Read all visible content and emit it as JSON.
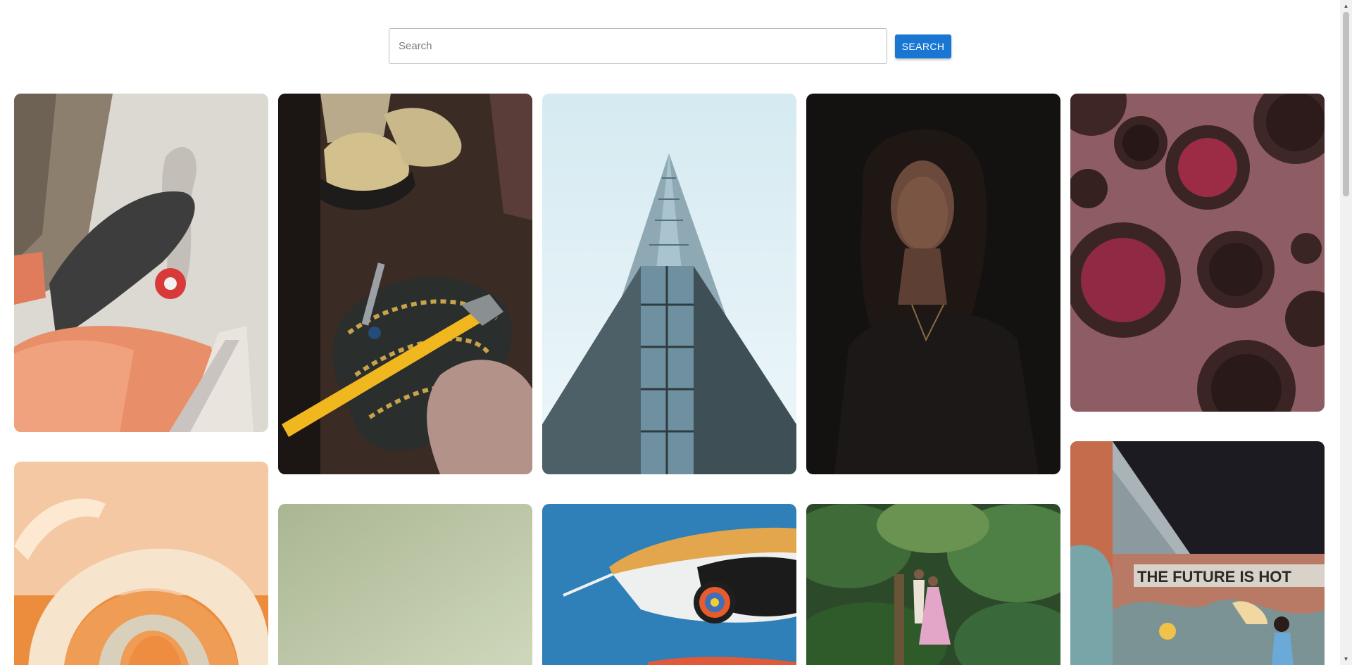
{
  "search": {
    "placeholder": "Search",
    "value": "",
    "button_label": "SEARCH",
    "button_color": "#1976d2"
  },
  "gallery": {
    "columns": [
      {
        "photos": [
          {
            "subject": "skateboard-photo",
            "palette": [
              "#d9d5cf",
              "#e8956f",
              "#3b3b3b"
            ]
          },
          {
            "subject": "arches-render-photo",
            "palette": [
              "#f2c49a",
              "#e88a3e",
              "#c9c0a8"
            ]
          }
        ]
      },
      {
        "photos": [
          {
            "subject": "climbing-gear-photo",
            "palette": [
              "#3a2a24",
              "#e8b72c",
              "#b19088"
            ]
          },
          {
            "subject": "green-gradient-photo",
            "palette": [
              "#b8c2a3",
              "#c8d1b4"
            ]
          }
        ]
      },
      {
        "photos": [
          {
            "subject": "skyscraper-photo",
            "palette": [
              "#dfeef3",
              "#6b8590",
              "#2f4047"
            ]
          },
          {
            "subject": "koi-kite-photo",
            "palette": [
              "#2d7ab5",
              "#e2a24a",
              "#1e1e1e"
            ]
          }
        ]
      },
      {
        "photos": [
          {
            "subject": "portrait-woman-photo",
            "palette": [
              "#141111",
              "#2a1f1c",
              "#6a4a3c"
            ]
          },
          {
            "subject": "garden-couple-photo",
            "palette": [
              "#2e5a2c",
              "#6a9a4c",
              "#e0a6c8"
            ]
          }
        ]
      },
      {
        "photos": [
          {
            "subject": "bowls-photo",
            "palette": [
              "#8d5c63",
              "#3a2424",
              "#b3334a"
            ]
          },
          {
            "subject": "graffiti-wall-photo",
            "palette": [
              "#1d1c22",
              "#b97761",
              "#5cb8c7"
            ],
            "sign_text": "THE FUTURE IS HOT"
          }
        ]
      }
    ]
  }
}
